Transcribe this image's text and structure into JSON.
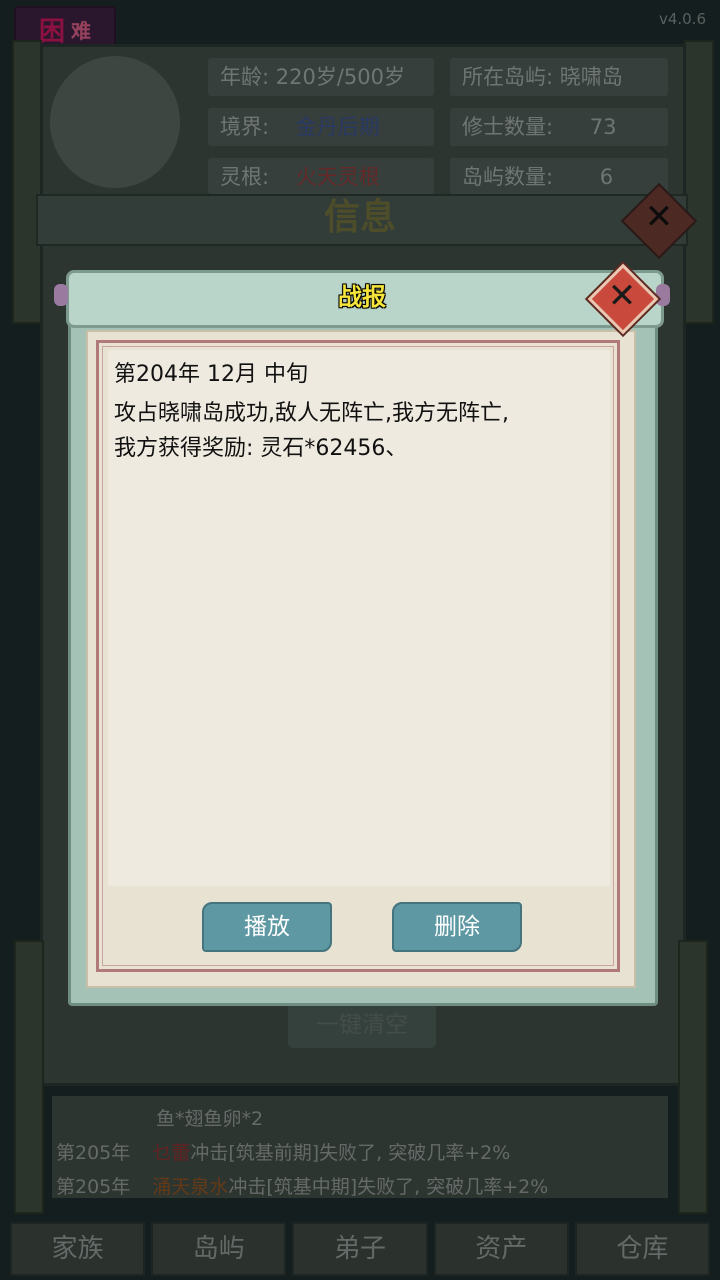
{
  "difficulty": {
    "big": "困",
    "small": "难"
  },
  "version": "v4.0.6",
  "character": {
    "age_label": "年龄:",
    "age_value": "220岁/500岁",
    "island_label": "所在岛屿:",
    "island_value": "晓啸岛",
    "realm_label": "境界:",
    "realm_value": "金丹后期",
    "cultivators_label": "修士数量:",
    "cultivators_value": "73",
    "root_label": "灵根:",
    "root_value": "火天灵根",
    "islands_label": "岛屿数量:",
    "islands_value": "6"
  },
  "info_panel": {
    "title": "信息",
    "clear_all": "一键清空"
  },
  "logs": {
    "line0": "鱼*翅鱼卵*2",
    "line1_year": "第205年",
    "line1_name": "乜蕾",
    "line1_text": "冲击[筑基前期]失败了, 突破几率+2%",
    "line2_year": "第205年",
    "line2_name": "涌天泉水",
    "line2_text": "冲击[筑基中期]失败了, 突破几率+2%"
  },
  "nav": {
    "tab1": "家族",
    "tab2": "岛屿",
    "tab3": "弟子",
    "tab4": "资产",
    "tab5": "仓库"
  },
  "dialog": {
    "title": "战报",
    "date": "第204年 12月 中旬",
    "line1": "攻占晓啸岛成功,敌人无阵亡,我方无阵亡,",
    "line2": "我方获得奖励: 灵石*62456、",
    "play_label": "播放",
    "delete_label": "删除"
  },
  "colors": {
    "title_yellow": "#f5e53a",
    "button_teal": "#5e98a3",
    "close_red": "#c94a3c"
  }
}
